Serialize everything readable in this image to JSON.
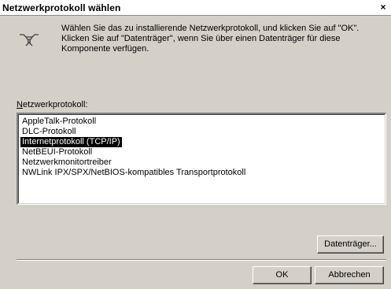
{
  "window": {
    "title": "Netzwerkprotokoll wählen",
    "close_label": "×"
  },
  "instructions": "Wählen Sie das zu installierende Netzwerkprotokoll, und klicken Sie auf \"OK\". Klicken Sie auf \"Datenträger\", wenn Sie über einen Datenträger für diese Komponente verfügen.",
  "protocol_list": {
    "label_prefix": "N",
    "label_rest": "etzwerkprotokoll:",
    "items": [
      {
        "label": "AppleTalk-Protokoll",
        "selected": false
      },
      {
        "label": "DLC-Protokoll",
        "selected": false
      },
      {
        "label": "Internetprotokoll (TCP/IP)",
        "selected": true
      },
      {
        "label": "NetBEUI-Protokoll",
        "selected": false
      },
      {
        "label": "Netzwerkmonitortreiber",
        "selected": false
      },
      {
        "label": "NWLink IPX/SPX/NetBIOS-kompatibles Transportprotokoll",
        "selected": false
      }
    ]
  },
  "buttons": {
    "disk_label": "Datenträger...",
    "ok_label": "OK",
    "cancel_label": "Abbrechen"
  },
  "icons": {
    "header": "network-cable-icon"
  },
  "colors": {
    "dialog_bg": "#d4d0c8",
    "selection_bg": "#000000",
    "selection_fg": "#ffffff"
  }
}
